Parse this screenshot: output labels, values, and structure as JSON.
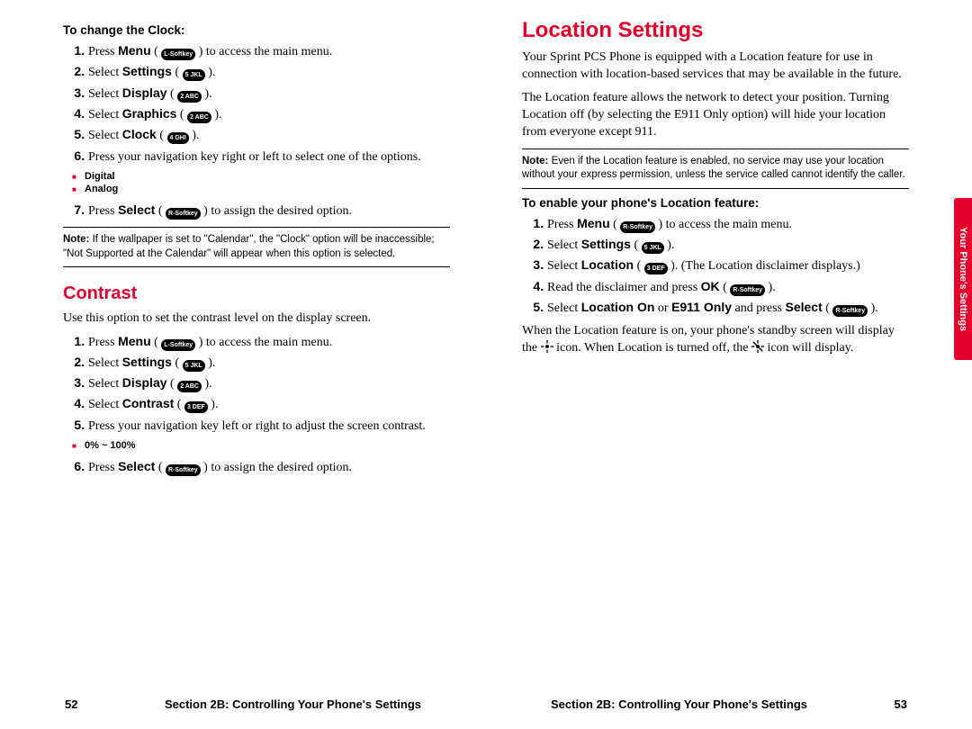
{
  "left": {
    "clock_head": "To change the Clock:",
    "clock_steps": {
      "s1a": "Press ",
      "s1b": "Menu",
      "s1c": " to access the main menu.",
      "s2a": "Select ",
      "s2b": "Settings",
      "s3a": "Select ",
      "s3b": "Display",
      "s4a": "Select ",
      "s4b": "Graphics",
      "s5a": "Select ",
      "s5b": "Clock",
      "s6": "Press your navigation key right or left to select one of the options.",
      "opt1": "Digital",
      "opt2": "Analog",
      "s7a": "Press ",
      "s7b": "Select",
      "s7c": " to assign the desired option."
    },
    "keys": {
      "menu": "L-Softkey",
      "five": "5 JKL",
      "two": "2 ABC",
      "four": "4 GHI",
      "rsoft": "R-Softkey",
      "three": "3 DEF"
    },
    "note1_label": "Note:",
    "note1": " If the wallpaper is set to \"Calendar\", the \"Clock\" option will be inaccessible; \"Not Supported at the Calendar\" will appear when this option is selected.",
    "contrast_title": "Contrast",
    "contrast_intro": "Use this option to set the contrast level on the display screen.",
    "contrast_steps": {
      "s1a": "Press ",
      "s1b": "Menu",
      "s1c": " to access the main menu.",
      "s2a": "Select ",
      "s2b": "Settings",
      "s3a": "Select ",
      "s3b": "Display",
      "s4a": "Select ",
      "s4b": "Contrast",
      "s5": "Press your navigation key left or right to adjust the screen contrast.",
      "range": "0% ~ 100%",
      "s6a": "Press ",
      "s6b": "Select",
      "s6c": " to assign the desired option."
    },
    "page_num": "52",
    "footer": "Section 2B: Controlling Your Phone's Settings"
  },
  "right": {
    "title": "Location Settings",
    "p1": "Your Sprint PCS Phone is equipped with a Location feature for use in connection with location-based services that may be available in the future.",
    "p2": "The Location feature allows the network to detect your position. Turning Location off (by selecting the E911 Only option) will hide your location from everyone except 911.",
    "note_label": "Note:",
    "note": " Even if the Location feature is enabled, no service may use your location without your express permission, unless the service called cannot identify the caller.",
    "enable_head": "To enable your phone's Location feature:",
    "steps": {
      "s1a": "Press ",
      "s1b": "Menu",
      "s1c": " to access the main menu.",
      "s2a": "Select ",
      "s2b": "Settings",
      "s3a": "Select ",
      "s3b": "Location",
      "s3c": ". (The Location disclaimer displays.)",
      "s4a": "Read the disclaimer and press ",
      "s4b": "OK",
      "s5a": "Select ",
      "s5b": "Location On",
      "s5c": " or ",
      "s5d": "E911 Only",
      "s5e": " and press ",
      "s5f": "Select"
    },
    "p3a": "When the Location feature is on, your phone's standby screen will display the ",
    "p3b": " icon. When Location is turned off, the ",
    "p3c": " icon will display.",
    "side_tab": "Your Phone's Settings",
    "page_num": "53",
    "footer": "Section 2B: Controlling Your Phone's Settings"
  }
}
